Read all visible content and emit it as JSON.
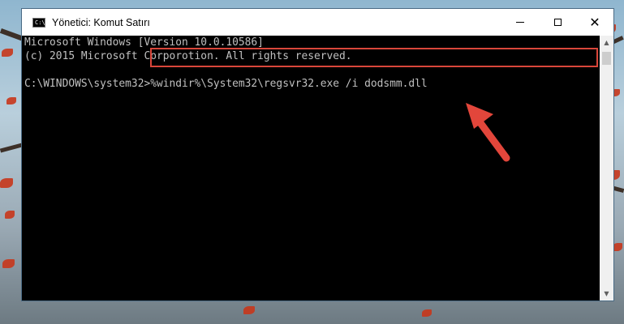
{
  "window": {
    "title": "Yönetici: Komut Satırı",
    "icon": "command-prompt-icon"
  },
  "controls": {
    "minimize_icon": "minimize-icon",
    "maximize_icon": "maximize-icon",
    "close_icon": "close-icon",
    "close_glyph": "✕"
  },
  "console": {
    "lines": [
      "Microsoft Windows [Version 10.0.10586]",
      "(c) 2015 Microsoft Corporotion. All rights reserved.",
      ""
    ],
    "prompt": "C:\\WINDOWS\\system32>",
    "command": "%windir%\\System32\\regsvr32.exe /i dodsmm.dll"
  },
  "scrollbar": {
    "up_glyph": "▲",
    "down_glyph": "▼"
  },
  "annotation": {
    "arrow_icon": "red-arrow-icon",
    "highlight_color": "#d9463a"
  }
}
